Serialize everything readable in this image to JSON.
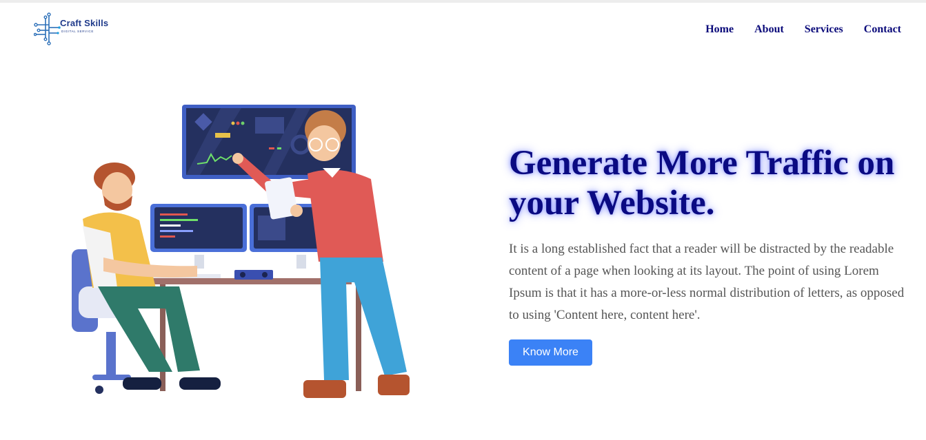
{
  "brand": {
    "name": "Craft Skills",
    "tagline": "DIGITAL SERVICE",
    "icon": "circuit-logo-icon"
  },
  "nav": {
    "items": [
      {
        "label": "Home"
      },
      {
        "label": "About"
      },
      {
        "label": "Services"
      },
      {
        "label": "Contact"
      }
    ]
  },
  "hero": {
    "title": "Generate More Traffic on your Website.",
    "body": "It is a long established fact that a reader will be distracted by the readable content of a page when looking at its layout. The point of using Lorem Ipsum is that it has a more-or-less normal distribution of letters, as opposed to using 'Content here, content here'.",
    "button_label": "Know More",
    "illustration": "two-developers-at-computer-desk-illustration"
  },
  "colors": {
    "nav_text": "#0a0a7a",
    "title": "#0a0a82",
    "title_glow": "#2838ff",
    "body_text": "#555555",
    "button": "#3b82f6",
    "brand": "#1f3a8a"
  }
}
